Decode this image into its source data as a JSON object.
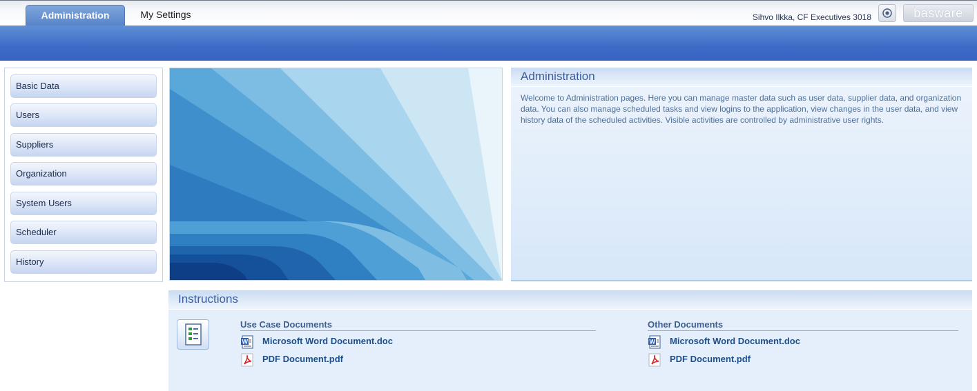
{
  "header": {
    "tabs": [
      {
        "label": "Administration",
        "active": true
      },
      {
        "label": "My Settings",
        "active": false
      }
    ],
    "user": "Sihvo Ilkka, CF Executives 3018",
    "brand": "basware"
  },
  "sidebar": {
    "items": [
      {
        "label": "Basic Data"
      },
      {
        "label": "Users"
      },
      {
        "label": "Suppliers"
      },
      {
        "label": "Organization"
      },
      {
        "label": "System Users"
      },
      {
        "label": "Scheduler"
      },
      {
        "label": "History"
      }
    ]
  },
  "admin": {
    "title": "Administration",
    "description": "Welcome to Administration pages. Here you can manage master data such as user data, supplier data, and organization data. You can also manage scheduled tasks and view logins to the application, view changes in the user data, and view history data of the scheduled activities. Visible activities are controlled by administrative user rights."
  },
  "instructions": {
    "title": "Instructions",
    "columns": [
      {
        "title": "Use Case Documents",
        "documents": [
          {
            "label": "Microsoft Word Document.doc",
            "icon": "word-doc-icon"
          },
          {
            "label": "PDF Document.pdf",
            "icon": "pdf-icon"
          }
        ]
      },
      {
        "title": "Other Documents",
        "documents": [
          {
            "label": "Microsoft Word Document.doc",
            "icon": "word-doc-icon"
          },
          {
            "label": "PDF Document.pdf",
            "icon": "pdf-icon"
          }
        ]
      }
    ]
  },
  "colors": {
    "accent": "#3d6cc7",
    "panel": "#e5effb",
    "link": "#1f4f8a"
  }
}
